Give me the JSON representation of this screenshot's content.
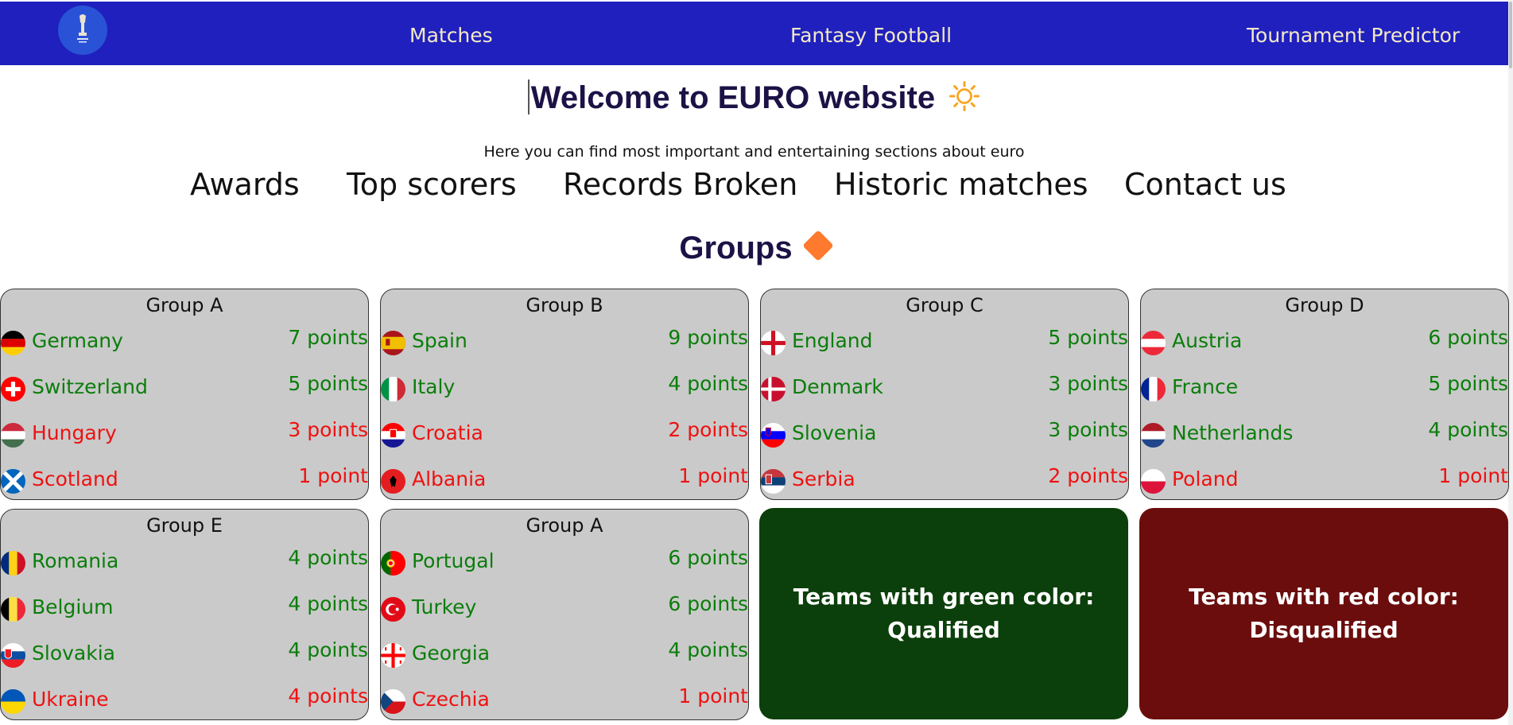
{
  "nav": {
    "logo_alt": "EURO 2024 logo",
    "links": [
      "Matches",
      "Fantasy Football",
      "Tournament Predictor"
    ]
  },
  "header": {
    "title": "Welcome to EURO website",
    "subtitle": "Here you can find most important and entertaining sections about euro"
  },
  "sections": [
    "Awards",
    "Top scorers",
    "Records Broken",
    "Historic matches",
    "Contact us"
  ],
  "groups_title": "Groups",
  "groups": [
    {
      "name": "Group A",
      "teams": [
        {
          "name": "Germany",
          "points": "7 points",
          "status": "qualified",
          "flag": "germany-flag"
        },
        {
          "name": "Switzerland",
          "points": "5 points",
          "status": "qualified",
          "flag": "switzerland-flag"
        },
        {
          "name": "Hungary",
          "points": "3 points",
          "status": "disqualified",
          "flag": "hungary-flag"
        },
        {
          "name": "Scotland",
          "points": "1 point",
          "status": "disqualified",
          "flag": "scotland-flag"
        }
      ]
    },
    {
      "name": "Group B",
      "teams": [
        {
          "name": "Spain",
          "points": "9 points",
          "status": "qualified",
          "flag": "spain-flag"
        },
        {
          "name": "Italy",
          "points": "4 points",
          "status": "qualified",
          "flag": "italy-flag"
        },
        {
          "name": "Croatia",
          "points": "2 points",
          "status": "disqualified",
          "flag": "croatia-flag"
        },
        {
          "name": "Albania",
          "points": "1 point",
          "status": "disqualified",
          "flag": "albania-flag"
        }
      ]
    },
    {
      "name": "Group C",
      "teams": [
        {
          "name": "England",
          "points": "5 points",
          "status": "qualified",
          "flag": "england-flag"
        },
        {
          "name": "Denmark",
          "points": "3 points",
          "status": "qualified",
          "flag": "denmark-flag"
        },
        {
          "name": "Slovenia",
          "points": "3 points",
          "status": "qualified",
          "flag": "slovenia-flag"
        },
        {
          "name": "Serbia",
          "points": "2 points",
          "status": "disqualified",
          "flag": "serbia-flag"
        }
      ]
    },
    {
      "name": "Group D",
      "teams": [
        {
          "name": "Austria",
          "points": "6 points",
          "status": "qualified",
          "flag": "austria-flag"
        },
        {
          "name": "France",
          "points": "5 points",
          "status": "qualified",
          "flag": "france-flag"
        },
        {
          "name": "Netherlands",
          "points": "4 points",
          "status": "qualified",
          "flag": "netherlands-flag"
        },
        {
          "name": "Poland",
          "points": "1 point",
          "status": "disqualified",
          "flag": "poland-flag"
        }
      ]
    },
    {
      "name": "Group E",
      "teams": [
        {
          "name": "Romania",
          "points": "4 points",
          "status": "qualified",
          "flag": "romania-flag"
        },
        {
          "name": "Belgium",
          "points": "4 points",
          "status": "qualified",
          "flag": "belgium-flag"
        },
        {
          "name": "Slovakia",
          "points": "4 points",
          "status": "qualified",
          "flag": "slovakia-flag"
        },
        {
          "name": "Ukraine",
          "points": "4 points",
          "status": "disqualified",
          "flag": "ukraine-flag"
        }
      ]
    },
    {
      "name": "Group A",
      "teams": [
        {
          "name": "Portugal",
          "points": "6 points",
          "status": "qualified",
          "flag": "portugal-flag"
        },
        {
          "name": "Turkey",
          "points": "6 points",
          "status": "qualified",
          "flag": "turkey-flag"
        },
        {
          "name": "Georgia",
          "points": "4 points",
          "status": "qualified",
          "flag": "georgia-flag"
        },
        {
          "name": "Czechia",
          "points": "1 point",
          "status": "disqualified",
          "flag": "czechia-flag"
        }
      ]
    }
  ],
  "legend": {
    "qualified": {
      "line1": "Teams with green color:",
      "line2": "Qualified",
      "color": "#0b3f0b"
    },
    "disqualified": {
      "line1": "Teams with red color:",
      "line2": "Disqualified",
      "color": "#6b0d0d"
    }
  },
  "colors": {
    "nav": "#1f20bd",
    "qualified_text": "#0b7d0b",
    "disqualified_text": "#ef1111",
    "card": "#cacaca"
  }
}
